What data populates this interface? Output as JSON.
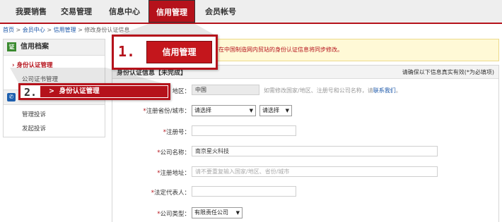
{
  "nav": {
    "items": [
      {
        "label": "我要销售"
      },
      {
        "label": "交易管理"
      },
      {
        "label": "信息中心"
      },
      {
        "label": "信用管理"
      },
      {
        "label": "会员帐号"
      }
    ],
    "active_index": 3
  },
  "breadcrumb": {
    "home": "首页",
    "sep": ">",
    "member_center": "会员中心",
    "credit_mgmt": "信用管理",
    "current": "修改身份认证信息"
  },
  "sidebar": {
    "section1_title": "信用档案",
    "section1_icon": "证",
    "items": [
      {
        "label": "身份认证管理"
      },
      {
        "label": "公司证书管理"
      }
    ],
    "section2_items": [
      {
        "label": "管理投诉"
      },
      {
        "label": "发起投诉"
      }
    ]
  },
  "notice": {
    "text": "在中国制造网内贸站的身份认证信息将同步修改。"
  },
  "form": {
    "title": "身份认证信息【未完成】",
    "note": "请确保以下信息真实有效(*为必填项)",
    "region_label": "地区：",
    "region_value": "中国",
    "region_hint": "如需修改国家/地区、注册号和公司名称，请",
    "contact_link": "联系我们",
    "province_label": "注册省份/城市：",
    "province_select": "请选择",
    "city_select": "请选择",
    "regno_label": "注册号：",
    "regno_value": "",
    "company_label": "公司名称：",
    "company_value": "南京星火科技",
    "address_label": "注册地址：",
    "address_placeholder": "请不要重复输入国家/地区、省份/城市",
    "legal_label": "法定代表人：",
    "legal_value": "",
    "type_label": "公司类型：",
    "type_value": "有限责任公司",
    "required_mark": "*"
  },
  "callouts": {
    "step1_num": "1.",
    "step1_label": "信用管理",
    "step2_num": "2.",
    "step2_label": "身份认证管理",
    "arrow": ">"
  },
  "colors": {
    "accent": "#b5121b",
    "link": "#1a56a8"
  }
}
